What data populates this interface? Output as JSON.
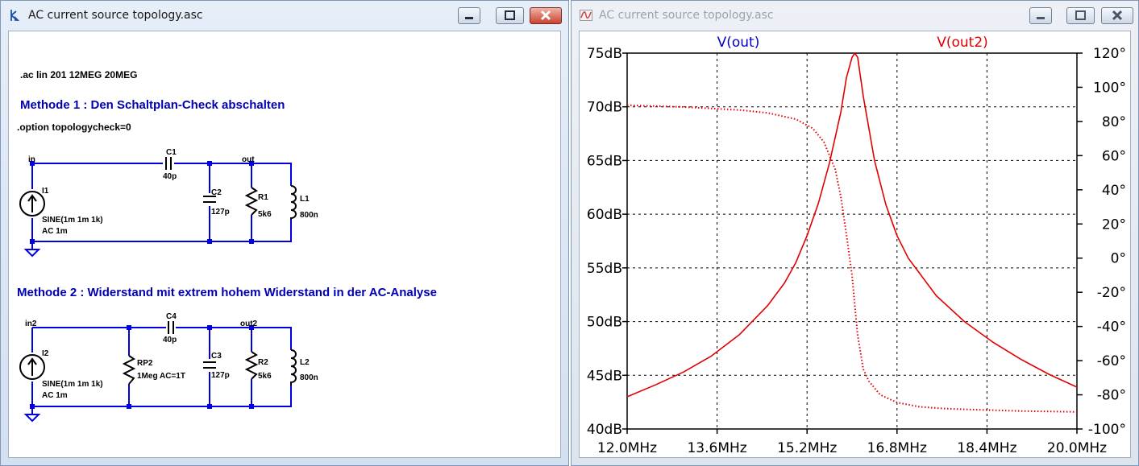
{
  "left_window": {
    "title": "AC current source topology.asc",
    "schematic": {
      "directive_ac": ".ac lin 201 12MEG 20MEG",
      "heading1": "Methode 1 : Den Schaltplan-Check abschalten",
      "directive_option": ".option topologycheck=0",
      "heading2": "Methode 2 : Widerstand mit extrem hohem Widerstand in der AC-Analyse",
      "circuit1": {
        "net_in": "in",
        "net_out": "out",
        "I1": {
          "name": "I1",
          "value1": "SINE(1m 1m 1k)",
          "value2": "AC 1m"
        },
        "C1": {
          "name": "C1",
          "value": "40p"
        },
        "C2": {
          "name": "C2",
          "value": "127p"
        },
        "R1": {
          "name": "R1",
          "value": "5k6"
        },
        "L1": {
          "name": "L1",
          "value": "800n"
        }
      },
      "circuit2": {
        "net_in": "in2",
        "net_out": "out2",
        "I2": {
          "name": "I2",
          "value1": "SINE(1m 1m 1k)",
          "value2": "AC 1m"
        },
        "RP2": {
          "name": "RP2",
          "value": "1Meg AC=1T"
        },
        "C4": {
          "name": "C4",
          "value": "40p"
        },
        "C3": {
          "name": "C3",
          "value": "127p"
        },
        "R2": {
          "name": "R2",
          "value": "5k6"
        },
        "L2": {
          "name": "L2",
          "value": "800n"
        }
      }
    }
  },
  "right_window": {
    "title": "AC current source topology.asc"
  },
  "colors": {
    "trace": "#e00000",
    "label_blue": "#0000c8",
    "wire": "#0000e0"
  },
  "chart_data": {
    "type": "line",
    "xlim": [
      12.0,
      20.0
    ],
    "x_tick_labels": [
      "12.0MHz",
      "13.6MHz",
      "15.2MHz",
      "16.8MHz",
      "18.4MHz",
      "20.0MHz"
    ],
    "x_ticks": [
      12.0,
      13.6,
      15.2,
      16.8,
      18.4,
      20.0
    ],
    "ylim_left": [
      40,
      75
    ],
    "y_left_ticks": [
      40,
      45,
      50,
      55,
      60,
      65,
      70,
      75
    ],
    "y_left_tick_labels": [
      "40dB",
      "45dB",
      "50dB",
      "55dB",
      "60dB",
      "65dB",
      "70dB",
      "75dB"
    ],
    "ylim_right": [
      -100,
      120
    ],
    "y_right_ticks": [
      -100,
      -80,
      -60,
      -40,
      -20,
      0,
      20,
      40,
      60,
      80,
      100,
      120
    ],
    "y_right_tick_labels": [
      "-100°",
      "-80°",
      "-60°",
      "-40°",
      "-20°",
      "0°",
      "20°",
      "40°",
      "60°",
      "80°",
      "100°",
      "120°"
    ],
    "grid": true,
    "legend": [
      "V(out)",
      "V(out2)"
    ],
    "series": [
      {
        "name": "V(out2)",
        "axis": "left",
        "style": "solid",
        "x": [
          12.0,
          12.5,
          13.0,
          13.5,
          14.0,
          14.5,
          14.8,
          15.0,
          15.2,
          15.4,
          15.6,
          15.8,
          15.9,
          16.0,
          16.05,
          16.1,
          16.2,
          16.4,
          16.6,
          16.8,
          17.0,
          17.5,
          18.0,
          18.5,
          19.0,
          19.5,
          20.0
        ],
        "y": [
          43.0,
          44.1,
          45.3,
          46.8,
          48.8,
          51.5,
          53.6,
          55.5,
          58.0,
          61.0,
          64.8,
          69.5,
          72.7,
          74.6,
          75.0,
          74.6,
          71.0,
          65.0,
          60.9,
          58.0,
          55.9,
          52.4,
          50.0,
          48.1,
          46.5,
          45.1,
          43.9
        ]
      },
      {
        "name": "V(out2) phase",
        "axis": "right",
        "style": "dotted",
        "x": [
          12.0,
          13.0,
          14.0,
          14.5,
          15.0,
          15.3,
          15.5,
          15.7,
          15.8,
          15.9,
          16.0,
          16.05,
          16.1,
          16.2,
          16.3,
          16.5,
          16.8,
          17.2,
          17.6,
          18.0,
          19.0,
          20.0
        ],
        "y": [
          89.5,
          88.5,
          86.7,
          85.0,
          81.3,
          76.0,
          68.0,
          52.0,
          36.0,
          14.0,
          -10.0,
          -28.0,
          -45.0,
          -65.0,
          -72.0,
          -80.0,
          -84.5,
          -87.0,
          -88.0,
          -88.5,
          -89.5,
          -90.0
        ]
      }
    ]
  }
}
